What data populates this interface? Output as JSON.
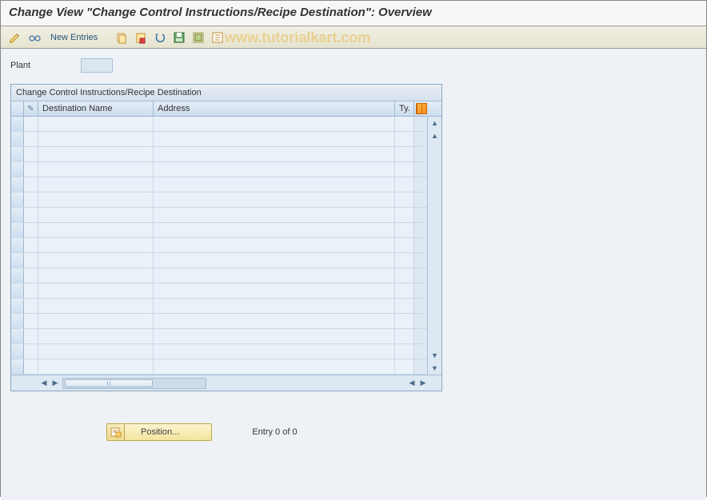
{
  "title": "Change View \"Change Control Instructions/Recipe Destination\": Overview",
  "toolbar": {
    "new_entries": "New Entries"
  },
  "watermark": "www.tutorialkart.com",
  "field": {
    "plant_label": "Plant",
    "plant_value": ""
  },
  "table": {
    "title": "Change Control Instructions/Recipe Destination",
    "columns": {
      "destination": "Destination Name",
      "address": "Address",
      "type": "Ty."
    },
    "rows": []
  },
  "footer": {
    "position_label": "Position...",
    "entry_text": "Entry 0 of 0"
  }
}
